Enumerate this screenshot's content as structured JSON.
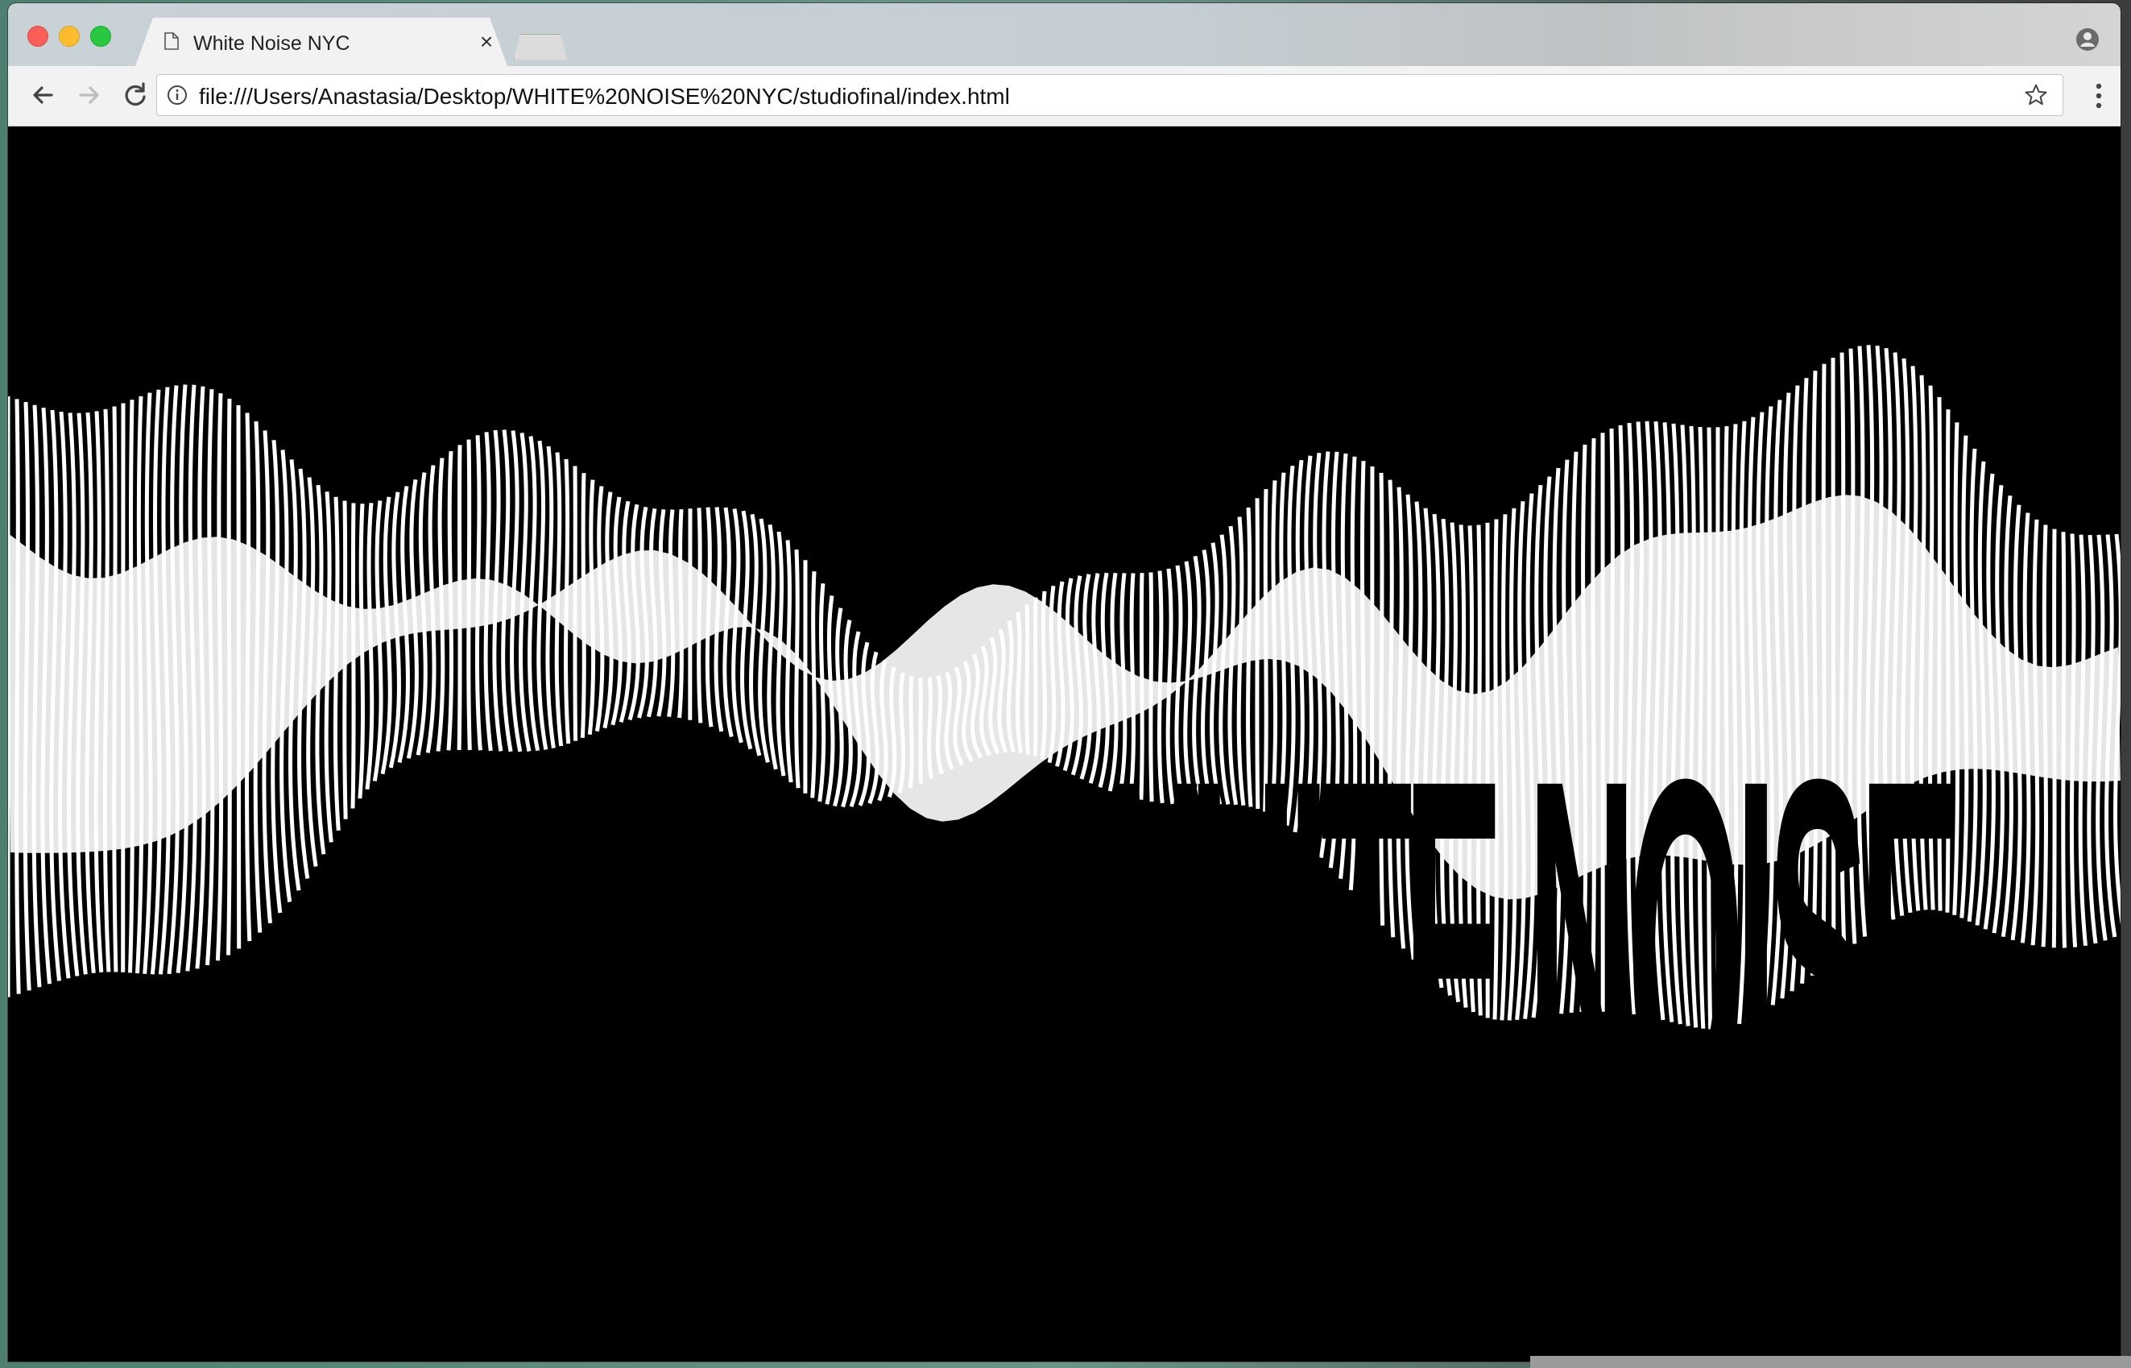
{
  "browser": {
    "tab": {
      "title": "White Noise NYC",
      "close_label": "×",
      "icon": "document-icon"
    },
    "toolbar": {
      "back_icon": "back-arrow-icon",
      "forward_icon": "forward-arrow-icon",
      "reload_icon": "reload-icon",
      "url": "file:///Users/Anastasia/Desktop/WHITE%20NOISE%20NYC/studiofinal/index.html",
      "info_icon": "info-icon",
      "bookmark_icon": "star-icon",
      "menu_icon": "kebab-menu-icon",
      "profile_icon": "profile-icon"
    }
  },
  "page": {
    "hero_title": "WHITE NOISE",
    "background_color": "#000000",
    "wave_color": "#ffffff"
  }
}
